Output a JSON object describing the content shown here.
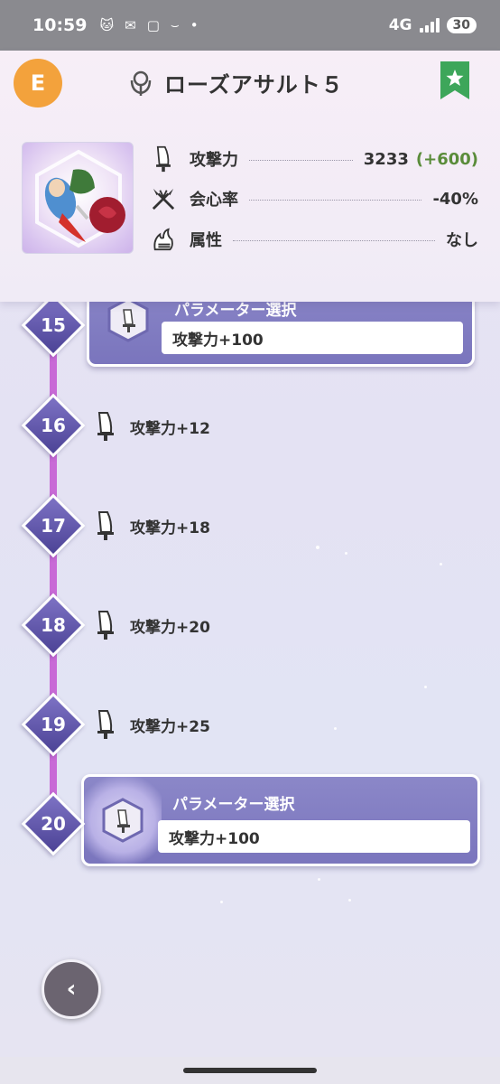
{
  "status_bar": {
    "time": "10:59",
    "network": "4G",
    "battery": "30"
  },
  "header": {
    "grade": "E",
    "title": "ローズアサルト５",
    "stats": [
      {
        "label": "攻撃力",
        "value": "3233",
        "bonus": "(+600)"
      },
      {
        "label": "会心率",
        "value": "-40%"
      },
      {
        "label": "属性",
        "value": "なし"
      }
    ]
  },
  "timeline": {
    "card_15": {
      "level": "15",
      "title": "パラメーター選択",
      "value": "攻撃力+100"
    },
    "rows": [
      {
        "level": "16",
        "text": "攻撃力+12"
      },
      {
        "level": "17",
        "text": "攻撃力+18"
      },
      {
        "level": "18",
        "text": "攻撃力+20"
      },
      {
        "level": "19",
        "text": "攻撃力+25"
      }
    ],
    "card_20": {
      "level": "20",
      "title": "パラメーター選択",
      "value": "攻撃力+100"
    }
  },
  "colors": {
    "accent": "#7a75bd",
    "timeline_line": "#c86ad6",
    "grade": "#f3a23c",
    "bonus": "#5a8c3a",
    "favorite": "#3da65a"
  },
  "back_button": {
    "label": "‹"
  }
}
